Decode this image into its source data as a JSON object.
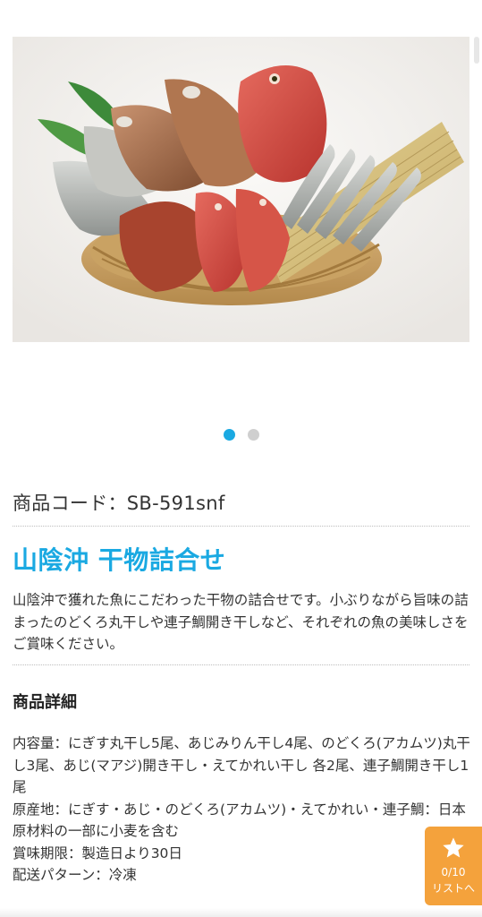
{
  "product": {
    "code_label": "商品コード：SB-591snf",
    "title": "山陰沖 干物詰合せ",
    "description": "山陰沖で獲れた魚にこだわった干物の詰合せです。小ぶりながら旨味の詰まったのどくろ丸干しや連子鯛開き干しなど、それぞれの魚の美味しさをご賞味ください。"
  },
  "carousel": {
    "slide_count": 2,
    "active_index": 0,
    "image_icon": "dried-fish-basket-photo"
  },
  "details": {
    "heading": "商品詳細",
    "rows": [
      "内容量：にぎす丸干し5尾、あじみりん干し4尾、のどくろ(アカムツ)丸干し3尾、あじ(マアジ)開き干し・えてかれい干し 各2尾、連子鯛開き干し1尾",
      "原産地：にぎす・あじ・のどくろ(アカムツ)・えてかれい・連子鯛：日本",
      "原材料の一部に小麦を含む",
      "賞味期限：製造日より30日",
      "配送パターン：冷凍"
    ]
  },
  "favorites": {
    "count": "0/10",
    "label": "リストへ",
    "icon": "star-icon"
  },
  "colors": {
    "accent": "#1aa9e2",
    "favorite_button": "#f4a23c",
    "dot_inactive": "#cfcfcf"
  }
}
